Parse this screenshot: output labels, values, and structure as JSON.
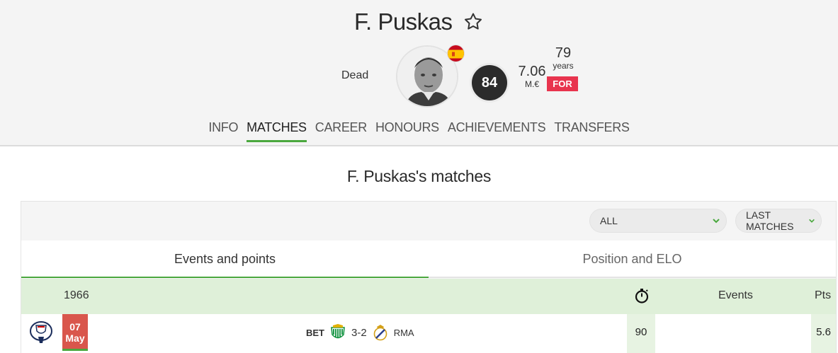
{
  "player": {
    "name": "F. Puskas",
    "status": "Dead",
    "rating": "84",
    "market_value": "7.06",
    "market_value_unit": "M.€",
    "age": "79",
    "age_unit": "years",
    "position": "FOR",
    "flag_icon": "spain-flag-icon"
  },
  "nav": {
    "tabs": [
      "INFO",
      "MATCHES",
      "CAREER",
      "HONOURS",
      "ACHIEVEMENTS",
      "TRANSFERS"
    ],
    "active": "MATCHES"
  },
  "section": {
    "title": "F. Puskas's matches"
  },
  "filters": {
    "competition": "ALL",
    "period": "LAST MATCHES"
  },
  "subtabs": {
    "events_points": "Events and points",
    "position_elo": "Position and ELO"
  },
  "table": {
    "year": "1966",
    "events_header": "Events",
    "pts_header": "Pts",
    "rows": [
      {
        "day": "07",
        "month": "May",
        "home": "BET",
        "score": "3-2",
        "away": "RMA",
        "minutes": "90",
        "events": "",
        "pts": "5.6"
      }
    ]
  },
  "colors": {
    "accent": "#4aa83e",
    "position_badge": "#e8344e",
    "date_box": "#d9564c",
    "table_header": "#dff0d9"
  }
}
